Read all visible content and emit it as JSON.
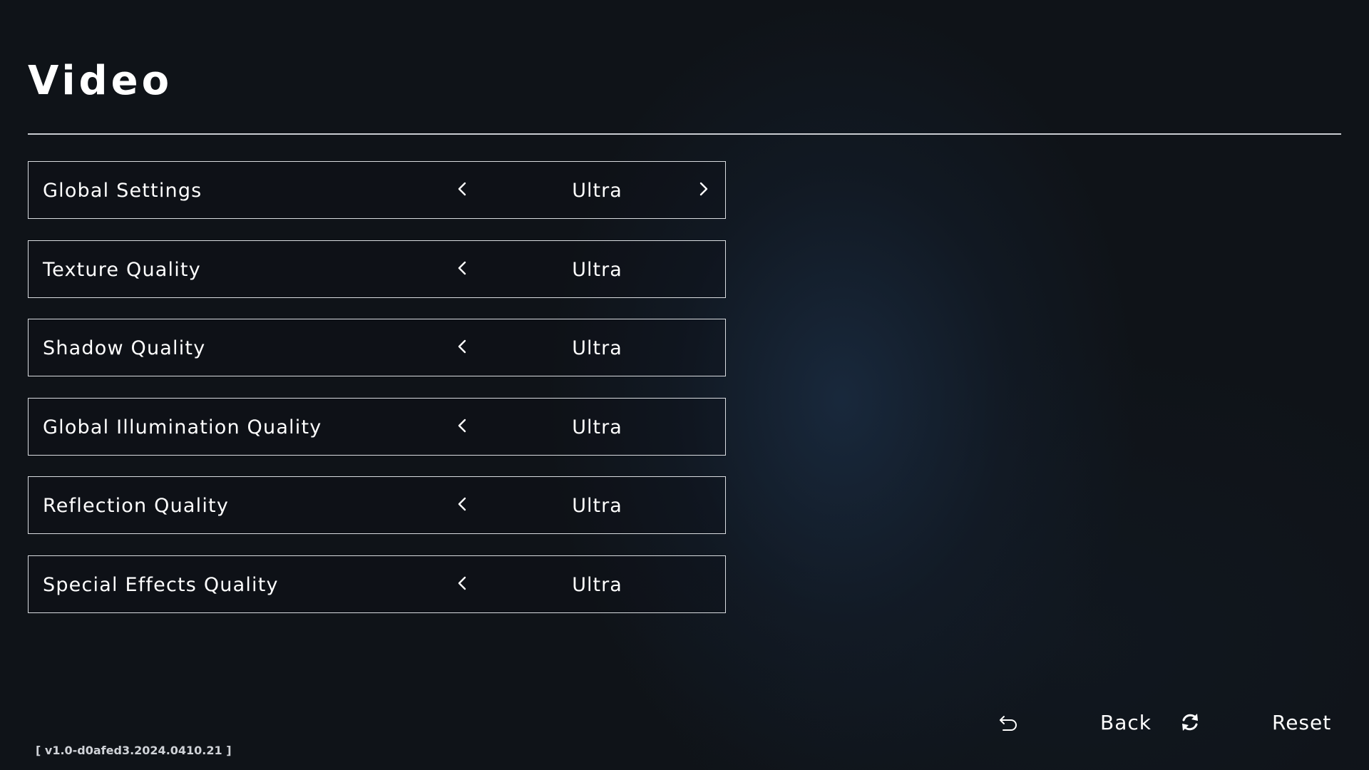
{
  "page": {
    "title": "Video"
  },
  "settings": [
    {
      "label": "Global Settings",
      "value": "Ultra",
      "has_prev": true,
      "has_next": true
    },
    {
      "label": "Texture Quality",
      "value": "Ultra",
      "has_prev": true,
      "has_next": false
    },
    {
      "label": "Shadow Quality",
      "value": "Ultra",
      "has_prev": true,
      "has_next": false
    },
    {
      "label": "Global Illumination Quality",
      "value": "Ultra",
      "has_prev": true,
      "has_next": false
    },
    {
      "label": "Reflection Quality",
      "value": "Ultra",
      "has_prev": true,
      "has_next": false
    },
    {
      "label": "Special Effects Quality",
      "value": "Ultra",
      "has_prev": true,
      "has_next": false
    }
  ],
  "footer": {
    "back": {
      "label": "Back",
      "icon": "back-arrow-icon"
    },
    "reset": {
      "label": "Reset",
      "icon": "refresh-icon"
    },
    "version": "[ v1.0-d0afed3.2024.0410.21 ]"
  },
  "colors": {
    "background": "#0f1318",
    "glow": "#1a2c42",
    "text": "#ffffff",
    "border": "#d9dce0"
  }
}
